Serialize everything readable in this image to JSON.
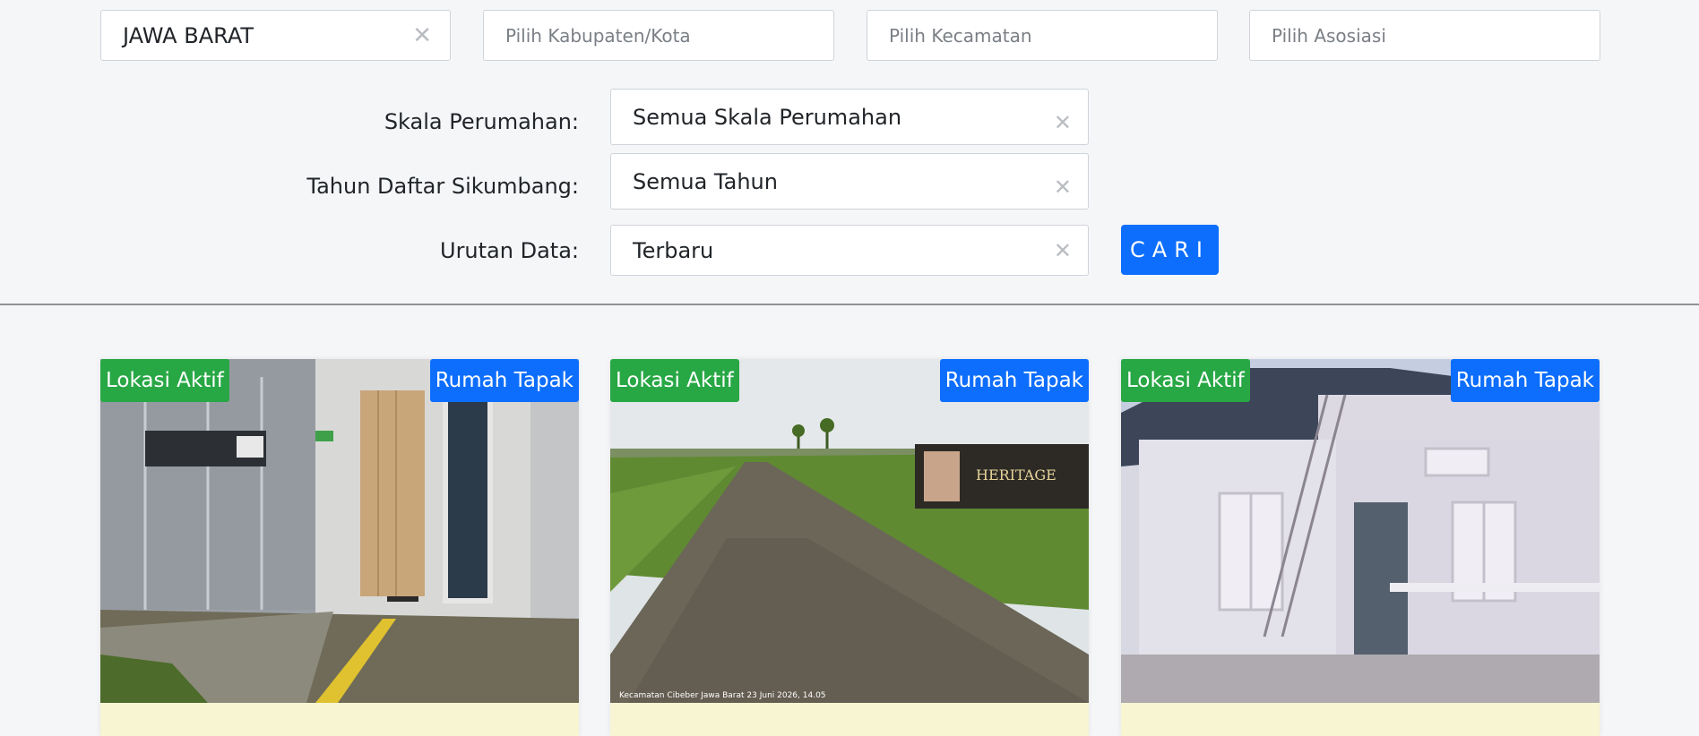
{
  "filters": {
    "province": {
      "value": "JAWA BARAT"
    },
    "kabupaten": {
      "placeholder": "Pilih Kabupaten/Kota"
    },
    "kecamatan": {
      "placeholder": "Pilih Kecamatan"
    },
    "asosiasi": {
      "placeholder": "Pilih Asosiasi"
    },
    "skala": {
      "label": "Skala Perumahan:",
      "value": "Semua Skala Perumahan"
    },
    "tahun": {
      "label": "Tahun Daftar Sikumbang:",
      "value": "Semua Tahun"
    },
    "urutan": {
      "label": "Urutan Data:",
      "value": "Terbaru"
    },
    "clear_symbol": "✕",
    "search_button": "CARI"
  },
  "cards": [
    {
      "status": "Lokasi Aktif",
      "type": "Rumah Tapak"
    },
    {
      "status": "Lokasi Aktif",
      "type": "Rumah Tapak",
      "photo_caption": "Kecamatan Cibeber Jawa Barat 23 Juni 2026, 14.05"
    },
    {
      "status": "Lokasi Aktif",
      "type": "Rumah Tapak"
    }
  ],
  "colors": {
    "primary": "#0d6efd",
    "success": "#28a745",
    "card_body": "#f7f5d2"
  }
}
